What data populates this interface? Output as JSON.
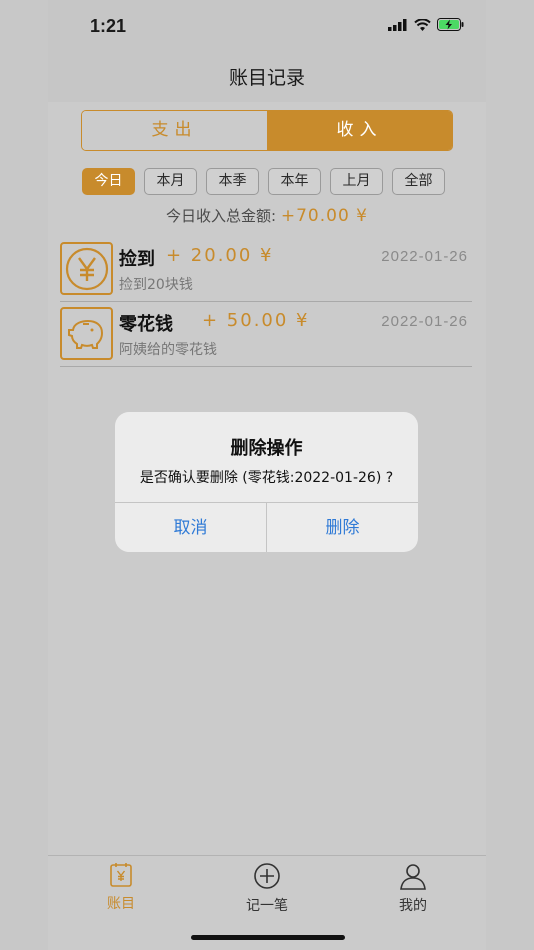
{
  "status": {
    "time": "1:21"
  },
  "nav": {
    "title": "账目记录"
  },
  "segment": {
    "expense": "支出",
    "income": "收入"
  },
  "filters": [
    "今日",
    "本月",
    "本季",
    "本年",
    "上月",
    "全部"
  ],
  "summary": {
    "label": "今日收入总金额:",
    "amount": "+70.00 ¥"
  },
  "records": [
    {
      "name": "捡到",
      "amount": "+ 20.00 ¥",
      "date": "2022-01-26",
      "note": "捡到20块钱",
      "icon": "yen-coin-icon"
    },
    {
      "name": "零花钱",
      "amount": "+ 50.00 ¥",
      "date": "2022-01-26",
      "note": "阿姨给的零花钱",
      "icon": "piggy-bank-icon"
    }
  ],
  "dialog": {
    "title": "删除操作",
    "message": "是否确认要删除 (零花钱:2022-01-26) ?",
    "cancel": "取消",
    "confirm": "删除"
  },
  "tabbar": {
    "accounts": "账目",
    "add": "记一笔",
    "mine": "我的"
  },
  "colors": {
    "accent": "#c88b2c",
    "link": "#2f7ad6"
  }
}
